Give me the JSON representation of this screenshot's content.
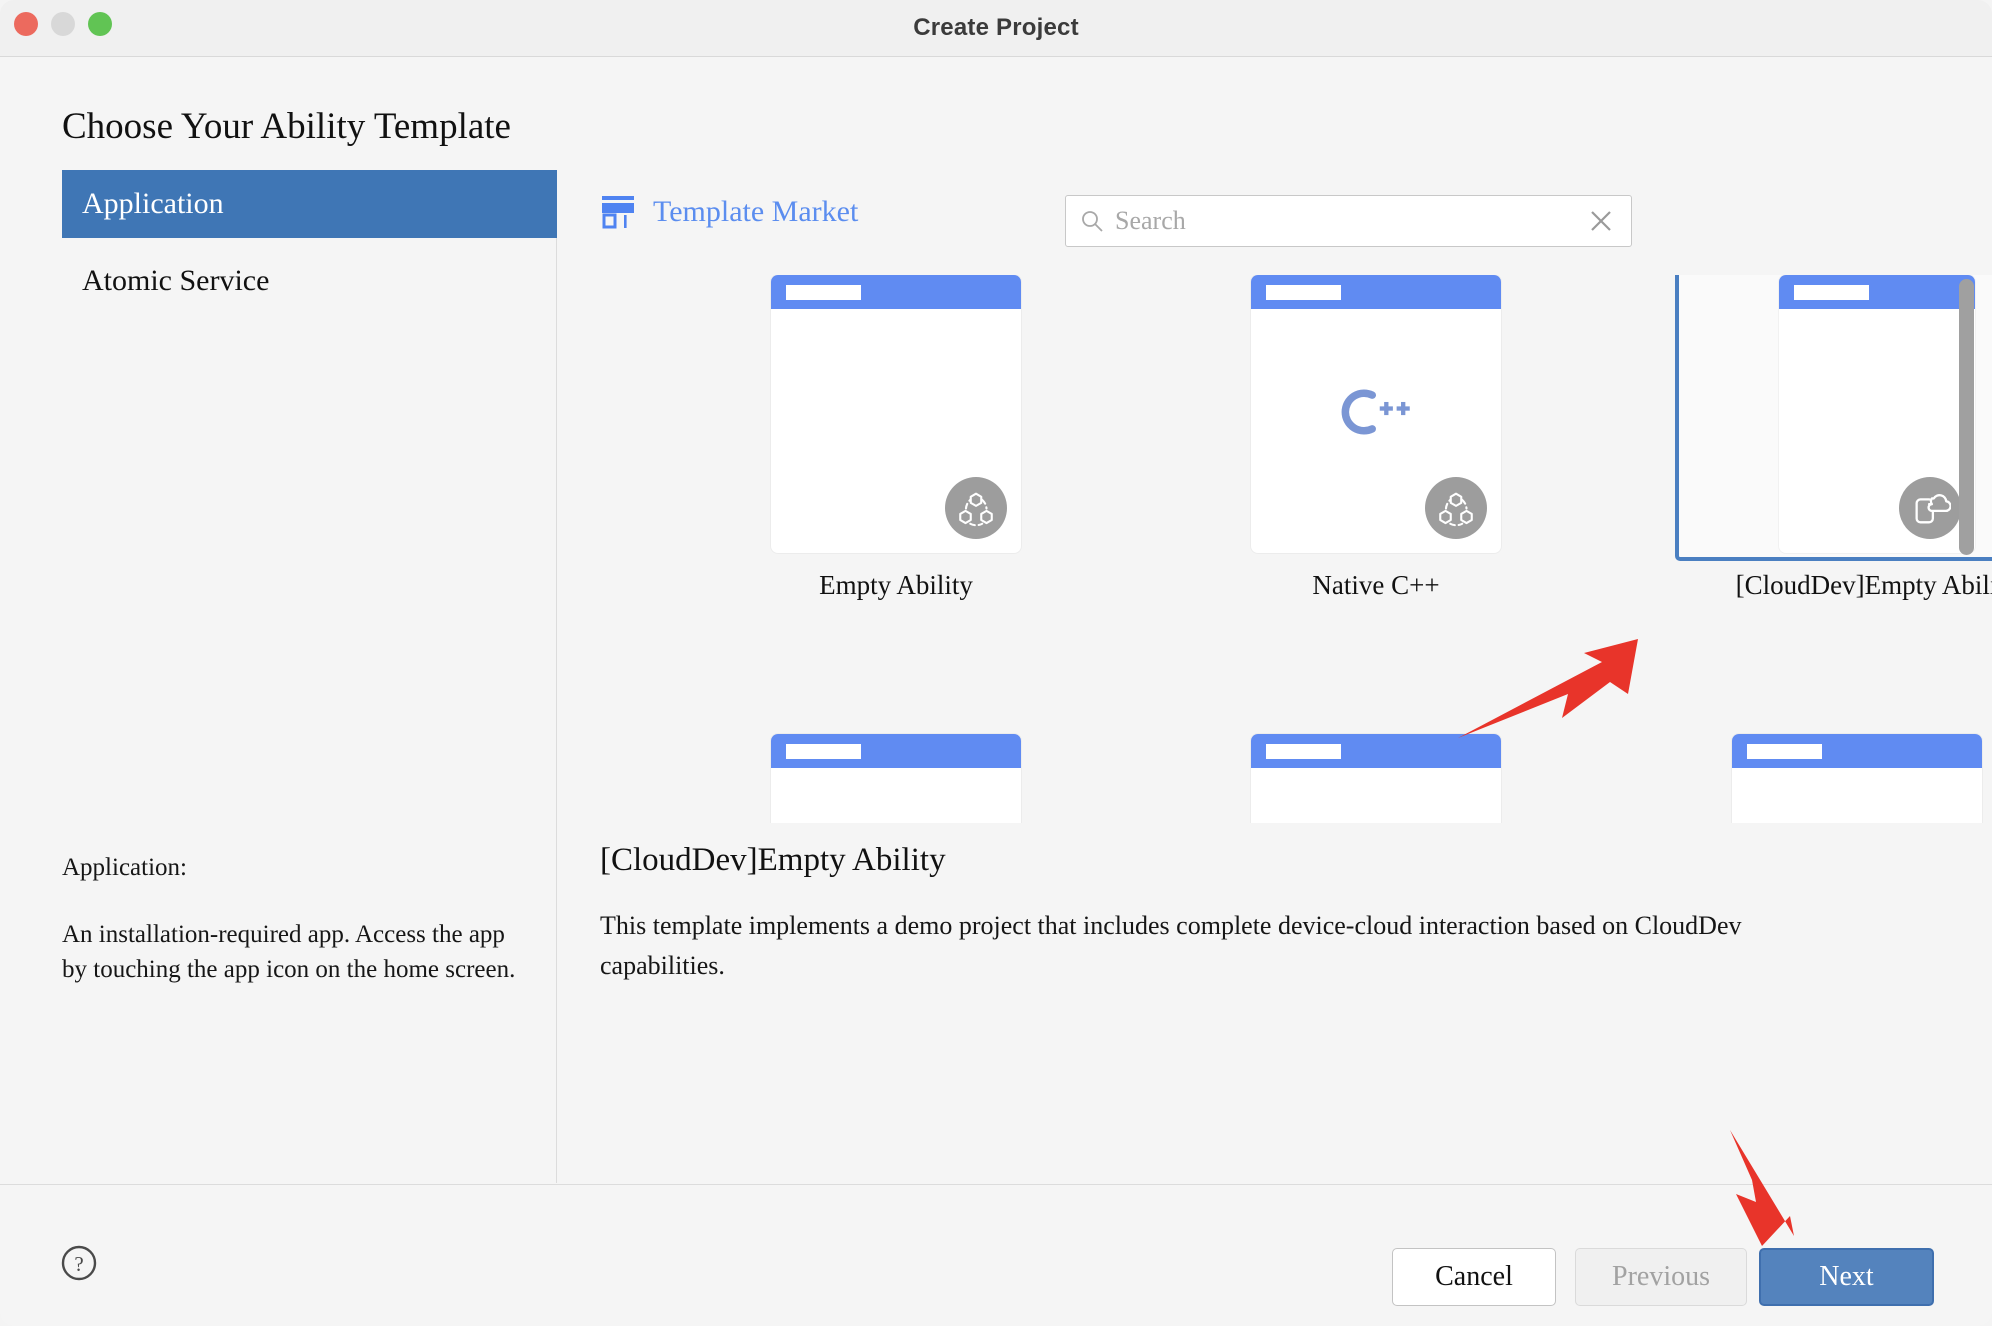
{
  "window": {
    "title": "Create Project",
    "traffic_lights": [
      "close-button",
      "minimize-button",
      "zoom-button"
    ]
  },
  "page_title": "Choose Your Ability Template",
  "sidebar": {
    "items": [
      {
        "label": "Application",
        "selected": true
      },
      {
        "label": "Atomic Service",
        "selected": false
      }
    ],
    "description_title": "Application:",
    "description_body": "An installation-required app. Access the app by touching the app icon on the home screen."
  },
  "panel": {
    "market_label": "Template Market",
    "market_icon": "store-icon",
    "search": {
      "placeholder": "Search",
      "value": "",
      "search_icon": "search-icon",
      "clear_icon": "close-icon"
    },
    "templates": [
      {
        "label": "Empty Ability",
        "badge": "distributed-icon",
        "selected": false,
        "art": "blank"
      },
      {
        "label": "Native C++",
        "badge": "distributed-icon",
        "selected": false,
        "art": "cpp-logo"
      },
      {
        "label": "[CloudDev]Empty Ability",
        "badge": "cloud-phone-icon",
        "selected": true,
        "art": "blank"
      },
      {
        "label": "",
        "badge": "",
        "selected": false,
        "art": "blank"
      },
      {
        "label": "",
        "badge": "",
        "selected": false,
        "art": "blank"
      },
      {
        "label": "",
        "badge": "",
        "selected": false,
        "art": "blank"
      }
    ],
    "detail": {
      "title": "[CloudDev]Empty Ability",
      "body": "This template implements a demo project that includes complete device-cloud interaction based on CloudDev capabilities."
    }
  },
  "footer": {
    "help_icon": "help-circle-icon",
    "cancel_label": "Cancel",
    "previous_label": "Previous",
    "next_label": "Next"
  },
  "annotations": {
    "arrow_to_template": "red-arrow-icon",
    "arrow_to_next": "red-arrow-icon"
  },
  "colors": {
    "accent_blue": "#4a7fc1",
    "card_blue": "#608bf2",
    "link_blue": "#5b8def",
    "sidebar_selected": "#3f76b5",
    "primary_button": "#5483bd",
    "annotation_red": "#e8342a",
    "badge_gray": "#9d9d9d"
  }
}
